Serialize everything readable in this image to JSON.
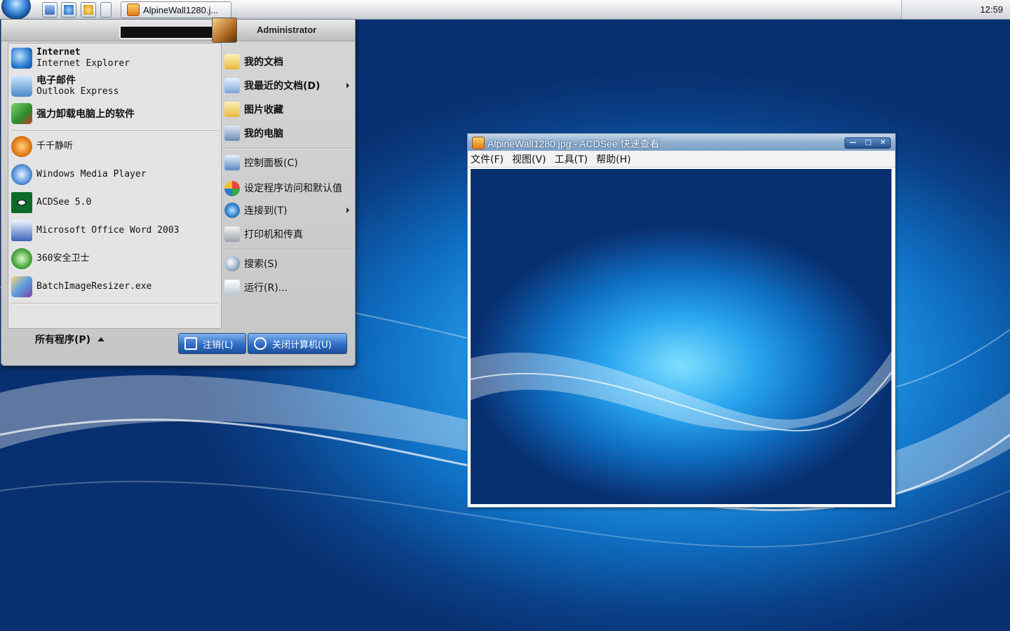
{
  "taskbar": {
    "quick_launch": [
      "show-desktop-icon",
      "internet-explorer-icon",
      "media-icon"
    ],
    "task_button_label": "AlpineWall1280.j...",
    "clock": "12:59"
  },
  "start_menu": {
    "user_name": "Administrator",
    "pinned": [
      {
        "title": "Internet",
        "subtitle": "Internet Explorer",
        "icon": "internet-explorer-icon"
      },
      {
        "title": "电子邮件",
        "subtitle": "Outlook Express",
        "icon": "outlook-express-icon"
      },
      {
        "title": "强力卸载电脑上的软件",
        "icon": "uninstaller-icon"
      }
    ],
    "recent": [
      {
        "label": "千千静听",
        "icon": "ttplayer-icon"
      },
      {
        "label": "Windows Media Player",
        "icon": "windows-media-player-icon"
      },
      {
        "label": "ACDSee 5.0",
        "icon": "acdsee-icon"
      },
      {
        "label": "Microsoft Office Word 2003",
        "icon": "word-icon"
      },
      {
        "label": "360安全卫士",
        "icon": "360-safe-icon"
      },
      {
        "label": "BatchImageResizer.exe",
        "icon": "batch-image-resizer-icon"
      }
    ],
    "all_programs_label": "所有程序(P)",
    "right": [
      {
        "label": "我的文档",
        "icon": "documents-folder-icon"
      },
      {
        "label": "我最近的文档(D)",
        "icon": "recent-documents-icon"
      },
      {
        "label": "图片收藏",
        "icon": "pictures-folder-icon"
      },
      {
        "label": "我的电脑",
        "icon": "my-computer-icon"
      },
      {
        "label": "控制面板(C)",
        "icon": "control-panel-icon"
      },
      {
        "label": "设定程序访问和默认值",
        "icon": "program-defaults-icon"
      },
      {
        "label": "连接到(T)",
        "icon": "connect-to-icon"
      },
      {
        "label": "打印机和传真",
        "icon": "printers-icon"
      },
      {
        "label": "搜索(S)",
        "icon": "search-icon"
      },
      {
        "label": "运行(R)...",
        "icon": "run-icon"
      }
    ],
    "logoff_label": "注销(L)",
    "shutdown_label": "关闭计算机(U)"
  },
  "acdsee": {
    "title": "AlpineWall1280.jpg - ACDSee 快速查看",
    "menu": [
      "文件(F)",
      "视图(V)",
      "工具(T)",
      "帮助(H)"
    ]
  },
  "colors": {
    "desktop_blue": "#0f6fc3",
    "start_button_blue": "#2f6dc5",
    "menu_gray": "#c6c6c6"
  }
}
